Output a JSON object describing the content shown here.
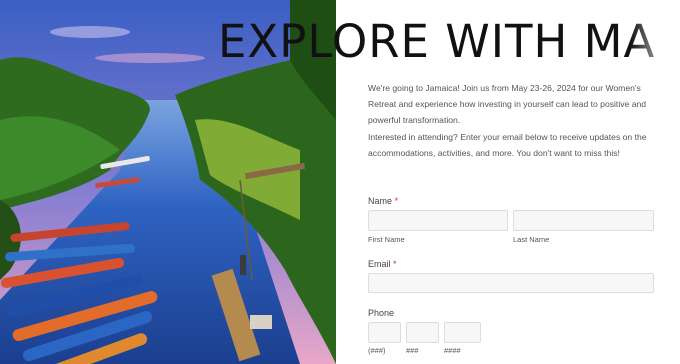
{
  "hero": {
    "image": "jamaica-river-boats-photo",
    "alt_colors": {
      "sky": "#4a6ec9",
      "water": "#2f5fb8",
      "foliage": "#2f6b1e"
    }
  },
  "title": "EXPLORE WITH MA",
  "intro": "We're going to Jamaica! Join us from May 23-26, 2024 for our Women's Retreat and experience how investing in yourself can lead to positive and powerful transformation.",
  "cta": "Interested in attending? Enter your email below to receive updates on the accommodations, activities, and more. You don't want to miss this!",
  "form": {
    "name_label": "Name",
    "required_mark": "*",
    "first_name_label": "First Name",
    "last_name_label": "Last Name",
    "email_label": "Email",
    "phone_label": "Phone",
    "phone_area_hint": "(###)",
    "phone_prefix_hint": "###",
    "phone_line_hint": "####"
  }
}
